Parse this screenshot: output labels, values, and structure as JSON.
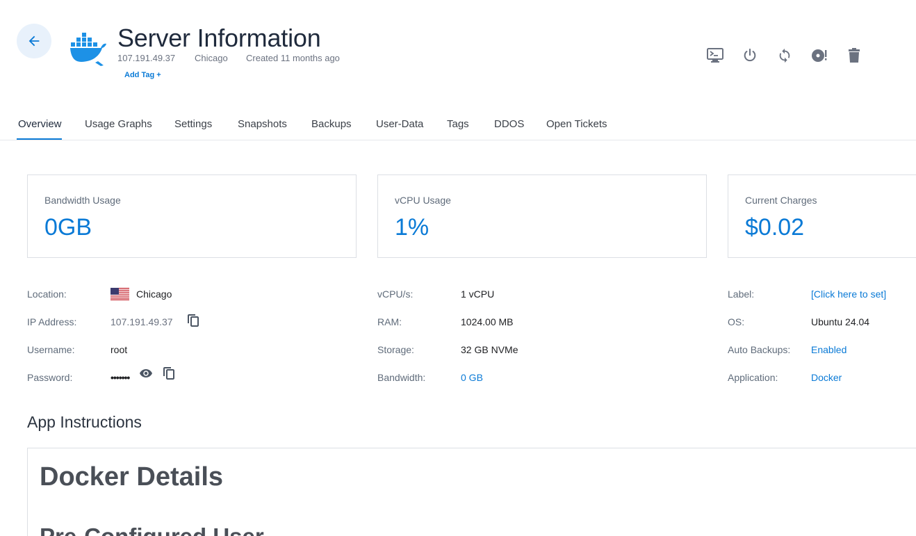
{
  "header": {
    "title": "Server Information",
    "ip": "107.191.49.37",
    "location": "Chicago",
    "created": "Created 11 months ago",
    "add_tag": "Add Tag +"
  },
  "actions": [
    "console-icon",
    "power-icon",
    "restart-icon",
    "reinstall-icon",
    "trash-icon"
  ],
  "tabs": [
    "Overview",
    "Usage Graphs",
    "Settings",
    "Snapshots",
    "Backups",
    "User-Data",
    "Tags",
    "DDOS",
    "Open Tickets"
  ],
  "cards": [
    {
      "label": "Bandwidth Usage",
      "value": "0GB"
    },
    {
      "label": "vCPU Usage",
      "value": "1%"
    },
    {
      "label": "Current Charges",
      "value": "$0.02"
    }
  ],
  "details": {
    "col1": [
      {
        "label": "Location:",
        "value": "Chicago"
      },
      {
        "label": "IP Address:",
        "value": "107.191.49.37"
      },
      {
        "label": "Username:",
        "value": "root"
      },
      {
        "label": "Password:",
        "value": "•••••••"
      }
    ],
    "col2": [
      {
        "label": "vCPU/s:",
        "value": "1 vCPU"
      },
      {
        "label": "RAM:",
        "value": "1024.00 MB"
      },
      {
        "label": "Storage:",
        "value": "32 GB NVMe"
      },
      {
        "label": "Bandwidth:",
        "value": "0 GB"
      }
    ],
    "col3": [
      {
        "label": "Label:",
        "value": "[Click here to set]"
      },
      {
        "label": "OS:",
        "value": "Ubuntu 24.04"
      },
      {
        "label": "Auto Backups:",
        "value": "Enabled"
      },
      {
        "label": "Application:",
        "value": "Docker"
      }
    ]
  },
  "instructions": {
    "section_title": "App Instructions",
    "heading": "Docker Details",
    "subheading": "Pre-Configured User"
  },
  "colors": {
    "accent": "#0a7ad6",
    "docker": "#1d91e6"
  }
}
